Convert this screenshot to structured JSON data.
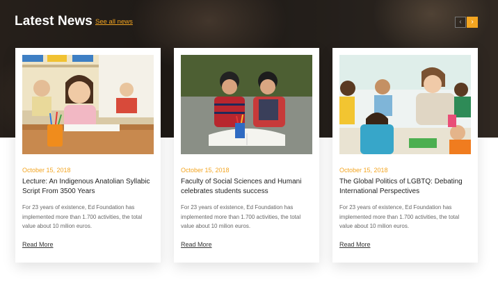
{
  "header": {
    "title": "Latest News",
    "see_all": "See all news",
    "prev_icon": "chevron-left-icon",
    "next_icon": "chevron-right-icon",
    "prev_glyph": "‹",
    "next_glyph": "›"
  },
  "colors": {
    "accent": "#f3a521",
    "title_text": "#222222",
    "body_text": "#666666"
  },
  "articles": [
    {
      "date": "October 15, 2018",
      "title": "Lecture: An Indigenous Anatolian Syllabic Script From 3500 Years",
      "excerpt": "For 23 years of existence, Ed Foundation has implemented more than 1.700 activities, the total value about 10 milion euros.",
      "read_more": "Read More"
    },
    {
      "date": "October 15, 2018",
      "title": "Faculty of Social Sciences and Humani celebrates students success",
      "excerpt": "For 23 years of existence, Ed Foundation has implemented more than 1.700 activities, the total value about 10 milion euros.",
      "read_more": "Read More"
    },
    {
      "date": "October 15, 2018",
      "title": "The Global Politics of LGBTQ: Debating International Perspectives",
      "excerpt": "For 23 years of existence, Ed Foundation has implemented more than 1.700 activities, the total value about 10 milion euros.",
      "read_more": "Read More"
    }
  ]
}
